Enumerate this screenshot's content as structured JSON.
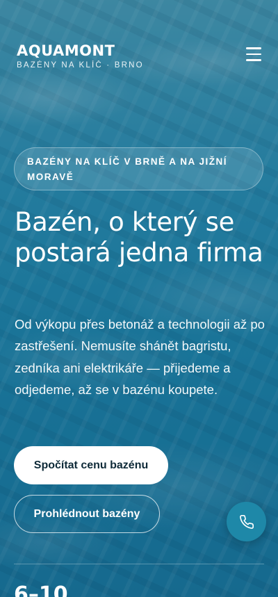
{
  "brand": {
    "name": "AQUAMONT",
    "tagline": "BAZÉNY NA KLÍČ · BRNO"
  },
  "nav": {
    "menu_icon": "hamburger-menu-icon"
  },
  "hero": {
    "badge": "BAZÉNY NA KLÍČ V BRNĚ A NA JIŽNÍ MORAVĚ",
    "headline": "Bazén, o který se postará jedna firma",
    "lead": "Od výkopu přes betonáž a technologii až po zastřešení. Nemusíte shánět bagristu, zedníka ani elektrikáře — přijedeme a odjedeme, až se v bazénu koupete.",
    "primary_cta": "Spočítat cenu bazénu",
    "secondary_cta": "Prohlédnout bazény"
  },
  "floating": {
    "call_icon": "phone-icon",
    "accent_color": "#1e88a8"
  },
  "stats": [
    {
      "value": "6–10"
    }
  ]
}
